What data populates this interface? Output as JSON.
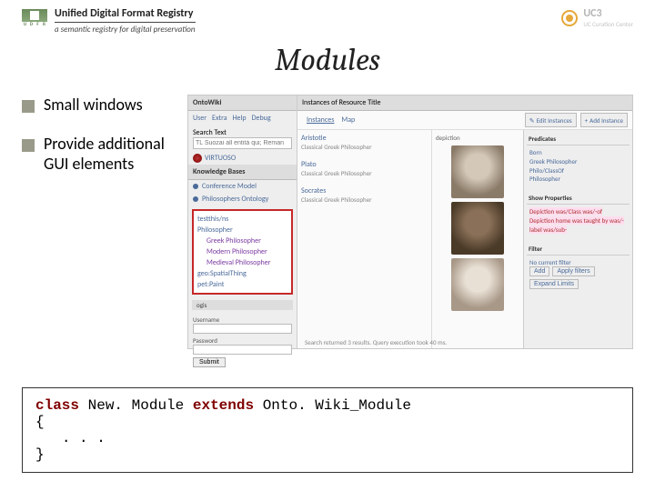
{
  "header": {
    "title": "Unified Digital Format Registry",
    "tagline": "a semantic registry for digital preservation",
    "udfr_letters": [
      "U",
      "D",
      "F",
      "R"
    ],
    "uc3_label": "UC3",
    "uc3_sub": "UC Curation Center"
  },
  "slide_title": "Modules",
  "bullets": [
    "Small windows",
    "Provide additional GUI elements"
  ],
  "screenshot": {
    "left": {
      "module_head": "OntoWiki",
      "tabs": [
        "User",
        "Extra",
        "Help",
        "Debug"
      ],
      "search_label": "Search Text",
      "search_placeholder": "TL Suozai all entità qui; Reman",
      "virtuoso_label": "VIRTUOSO",
      "kb_head": "Knowledge Bases",
      "kb_items": [
        "Conference Model",
        "Philosophers Ontology"
      ],
      "redbox": {
        "title": "testthis/ns",
        "items": [
          "Philosopher",
          "Greek Philosopher",
          "Modern Philosopher",
          "Medieval Philosopher",
          "geo:SpatialThing",
          "pet:Paint"
        ]
      },
      "tag": "ogis",
      "login": {
        "u_label": "Username",
        "p_label": "Password",
        "submit": "Submit"
      }
    },
    "right": {
      "head": "Instances of Resource Title",
      "tabs": [
        "Instances",
        "Map"
      ],
      "edit_btn": "Edit Instances",
      "add_btn": "Add Instance",
      "depict_head": "depiction",
      "items": [
        {
          "name": "Aristotle",
          "sub": "Classical Greek Philosopher"
        },
        {
          "name": "Plato",
          "sub": "Classical Greek Philosopher"
        },
        {
          "name": "Socrates",
          "sub": "Classical Greek Philosopher"
        }
      ],
      "predicates_head": "Predicates",
      "predicates_body": [
        "Born",
        "Greek Philosopher",
        "Philo/ClassOf",
        "Philosopher"
      ],
      "show_head": "Show Properties",
      "show_body": "Depiction  was/Class  was/-of  Depiction  home  was taught by  was/-label  was/sub-",
      "filter_head": "Filter",
      "filter_none": "No current filter",
      "filter_btns": [
        "Add",
        "Apply filters"
      ],
      "expand_btn": "Expand Limits",
      "footer": "Search returned 3 results.   Query execution took 40 ms."
    }
  },
  "code": {
    "kw_class": "class",
    "name": "New. Module",
    "kw_extends": "extends",
    "parent": "Onto. Wiki_Module",
    "body": ". . ."
  }
}
